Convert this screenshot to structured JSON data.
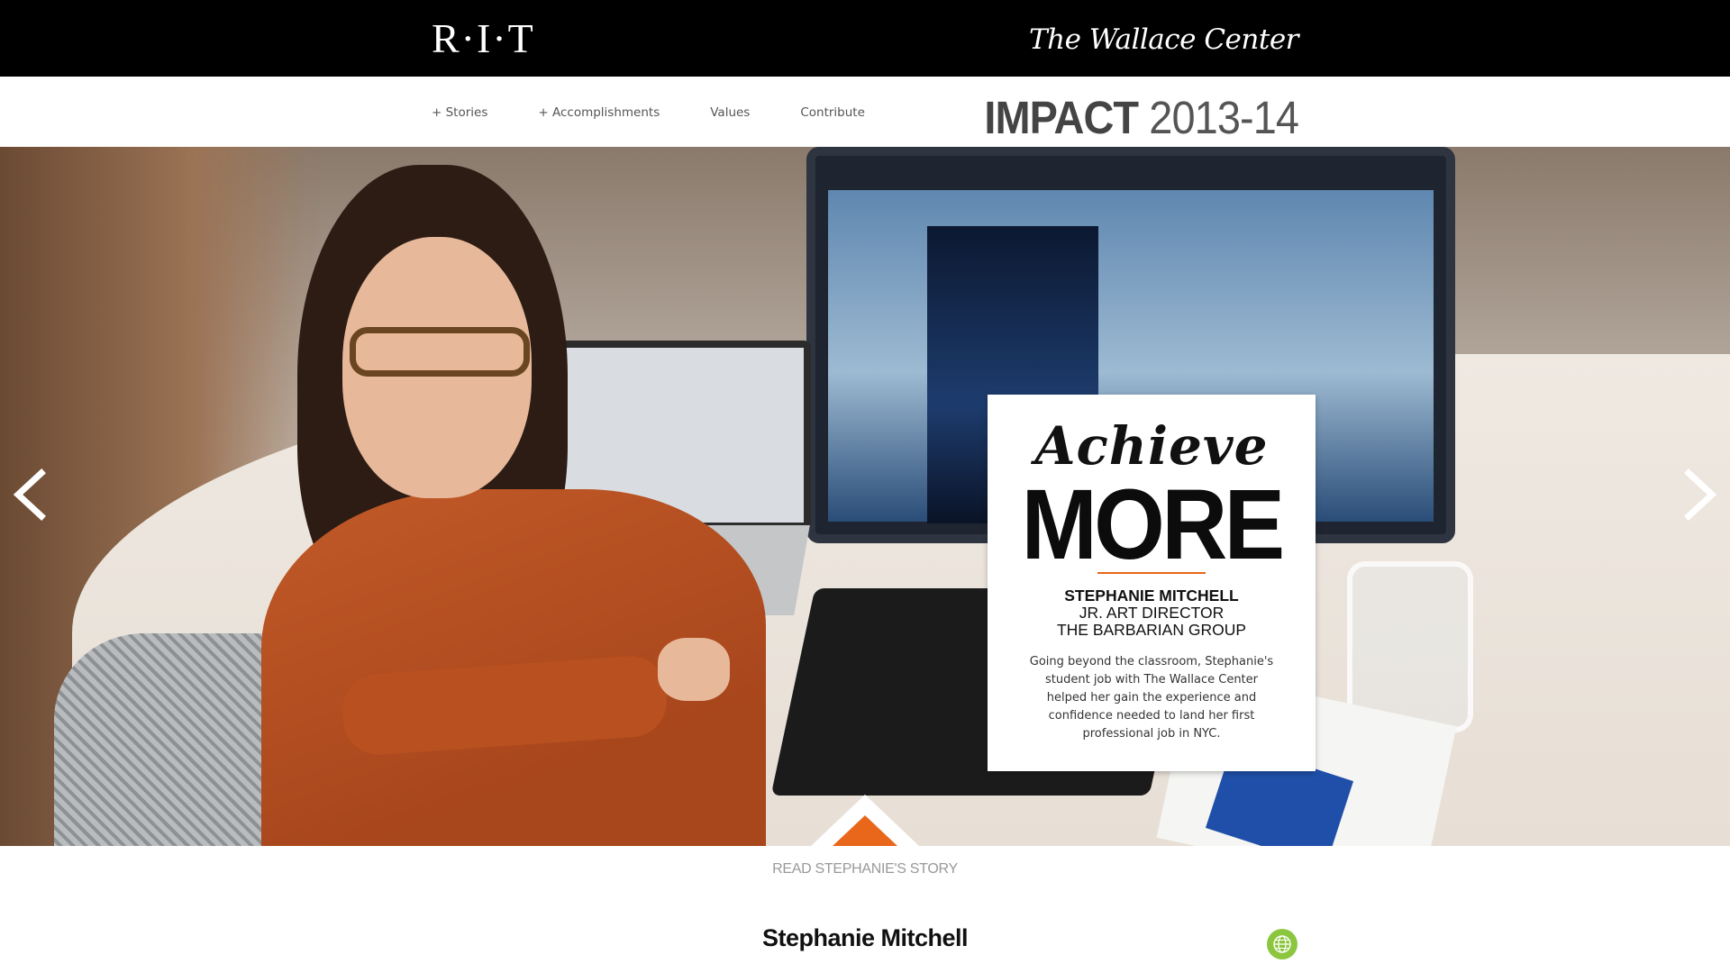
{
  "header": {
    "rit_logo": "R·I·T",
    "wallace_logo": "The Wallace Center"
  },
  "nav": {
    "items": [
      "+ Stories",
      "+ Accomplishments",
      "Values",
      "Contribute"
    ],
    "impact_bold": "IMPACT",
    "impact_year": "2013-14"
  },
  "hero": {
    "card": {
      "script_word": "Achieve",
      "headline": "MORE",
      "name": "STEPHANIE MITCHELL",
      "role": "JR. ART DIRECTOR",
      "organization": "THE BARBARIAN GROUP",
      "body": "Going beyond the classroom, Stephanie's student job with The Wallace Center helped her gain the experience and confidence needed to land her first professional job in NYC."
    },
    "accent_color": "#e8671b"
  },
  "story": {
    "read_label": "READ STEPHANIE'S STORY",
    "name": "Stephanie Mitchell"
  },
  "icons": {
    "prev": "chevron-left-icon",
    "next": "chevron-right-icon",
    "tab": "triangle-up-icon",
    "globe": "globe-icon"
  },
  "colors": {
    "topbar": "#000000",
    "accent": "#e8671b",
    "globe": "#8cc63f"
  }
}
